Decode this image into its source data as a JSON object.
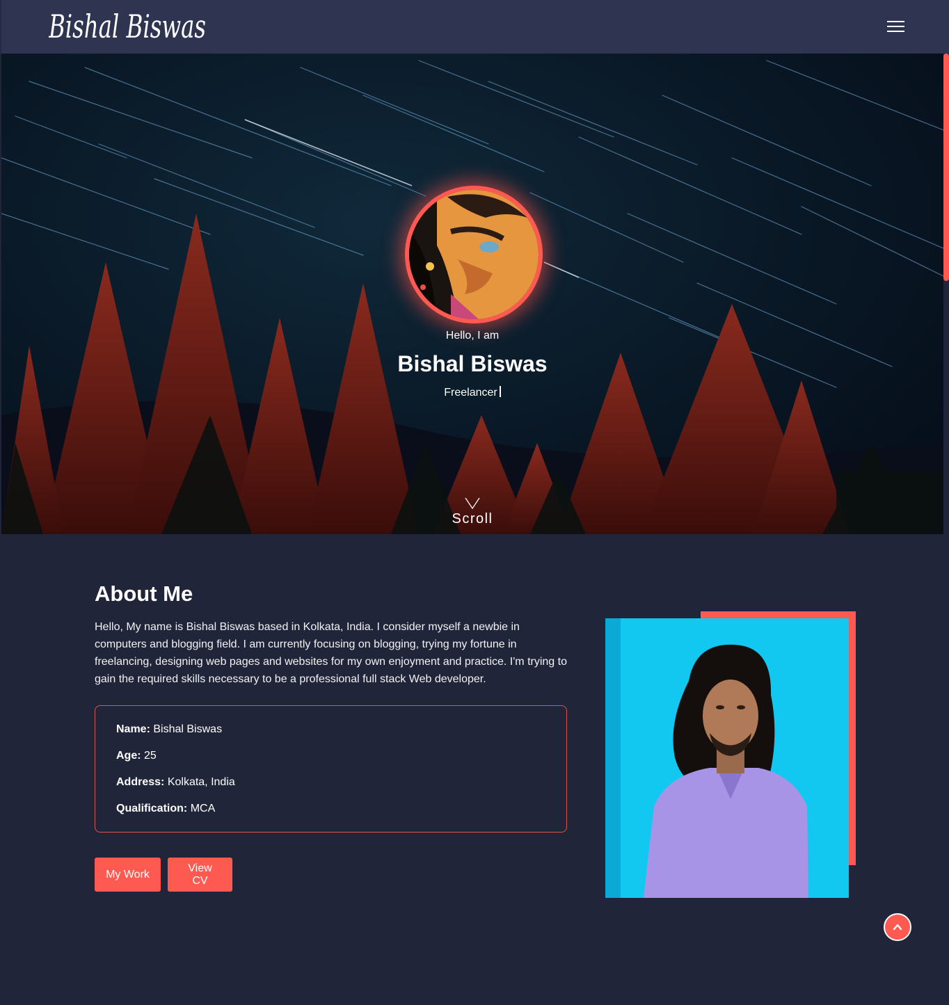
{
  "brand": {
    "logo_text": "Bishal Biswas"
  },
  "nav": {
    "menu_icon": "hamburger-menu-icon"
  },
  "hero": {
    "greeting": "Hello, I am",
    "name": "Bishal Biswas",
    "role": "Freelancer",
    "scroll_label": "Scroll",
    "scroll_icon": "chevron-down-icon"
  },
  "about": {
    "title": "About Me",
    "paragraph": "Hello, My name is Bishal Biswas based in Kolkata, India. I consider myself a newbie in computers and blogging field. I am currently focusing on blogging, trying my fortune in freelancing, designing web pages and websites for my own enjoyment and practice. I'm trying to gain the required skills necessary to be a professional full stack Web developer.",
    "info": [
      {
        "label": "Name:",
        "value": "Bishal Biswas"
      },
      {
        "label": "Age:",
        "value": "25"
      },
      {
        "label": "Address:",
        "value": "Kolkata, India"
      },
      {
        "label": "Qualification:",
        "value": "MCA"
      }
    ],
    "buttons": {
      "work": "My Work",
      "cv": "View CV"
    }
  },
  "back_to_top": {
    "icon": "chevron-up-icon"
  },
  "colors": {
    "accent": "#ff5a52",
    "navbar": "#2f3551",
    "page_bg": "#21253a",
    "photo_bg": "#12c8f0"
  }
}
